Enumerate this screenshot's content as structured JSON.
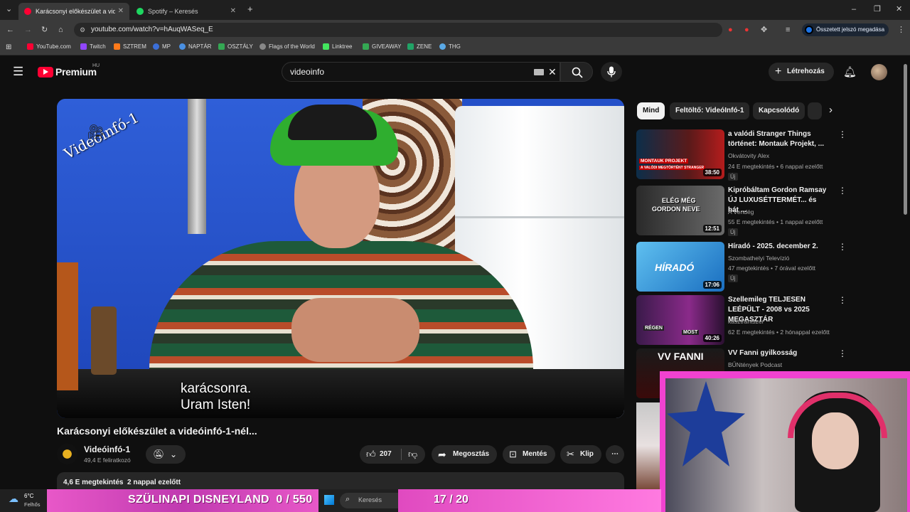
{
  "browser": {
    "tabs": [
      {
        "title": "Karácsonyi előkészület a videói...",
        "active": true,
        "favicon_color": "#ff0033"
      },
      {
        "title": "Spotify – Keresés",
        "active": false,
        "favicon_color": "#1ed760"
      }
    ],
    "new_tab": "+",
    "url": "youtube.com/watch?v=hAuqWASeq_E",
    "password_chip": "Összetett jelszó megadása",
    "bookmarks": [
      {
        "label": "YouTube.com",
        "color": "#ff0033"
      },
      {
        "label": "Twitch",
        "color": "#9146ff"
      },
      {
        "label": "SZTREM",
        "color": "#ff7a1a"
      },
      {
        "label": "MP",
        "color": "#3b6fd8"
      },
      {
        "label": "NAPTÁR",
        "color": "#4a90e2"
      },
      {
        "label": "OSZTÁLY",
        "color": "#34a853"
      },
      {
        "label": "Flags of the World",
        "color": "#888888"
      },
      {
        "label": "Linktree",
        "color": "#43e55e"
      },
      {
        "label": "GIVEAWAY",
        "color": "#34a853"
      },
      {
        "label": "ZENE",
        "color": "#21a366"
      },
      {
        "label": "THG",
        "color": "#5aa9e6"
      }
    ]
  },
  "yt": {
    "logo": "Premium",
    "region": "HU",
    "search_value": "videoinfo",
    "create_label": "Létrehozás"
  },
  "video": {
    "watermark": "Videóinfó-1",
    "caption_line1": "karácsonra.",
    "caption_line2": "Uram Isten!",
    "title": "Karácsonyi előkészület a videóinfó-1-nél...",
    "channel": "Videóinfó-1",
    "subscribers": "49,4 E feliratkozó",
    "likes": "207",
    "share": "Megosztás",
    "save": "Mentés",
    "clip": "Klip",
    "views_line": "4,6 E megtekintés  2 nappal ezelőtt"
  },
  "filters": [
    {
      "label": "Mind",
      "selected": true
    },
    {
      "label": "Feltöltő: VideóInfó-1",
      "selected": false
    },
    {
      "label": "Kapcsolódó",
      "selected": false
    }
  ],
  "recommendations": [
    {
      "title": "a valódi Stranger Things történet: Montauk Projekt, ...",
      "channel": "Okvátovity Alex",
      "meta": "24 E megtekintés • 6 nappal ezelőtt",
      "badge": "Új",
      "duration": "38:50"
    },
    {
      "title": "Kipróbáltam Gordon Ramsay ÚJ LUXUSÉTTERMÉT... és hát ...",
      "channel": "A Vendég",
      "meta": "55 E megtekintés • 1 nappal ezelőtt",
      "badge": "Új",
      "duration": "12:51"
    },
    {
      "title": "Híradó - 2025. december 2.",
      "channel": "Szombathelyi Televízió",
      "meta": "47 megtekintés • 7 órával ezelőtt",
      "badge": "Új",
      "duration": "17:06"
    },
    {
      "title": "Szellemileg TELJESEN LEÉPÜLT - 2008 vs 2025 MEGASZTÁR",
      "channel": "kasztrantszer",
      "meta": "62 E megtekintés • 2 hónappal ezelőtt",
      "badge": "",
      "duration": "40:26"
    },
    {
      "title": "VV Fanni gyilkosság",
      "channel": "BŰNtények Podcast",
      "meta": "",
      "badge": "",
      "duration": ""
    }
  ],
  "thumb_text": {
    "r0a": "MONTAUK PROJEKT",
    "r0b": "A VALÓDI MEGTÖRTÉNT STRANGER",
    "r1a": "ELÉG MÉG",
    "r1b": "GORDON NEVE",
    "r2": "HÍRADÓ",
    "r3a": "RÉGEN",
    "r3b": "MOST",
    "r4": "VV FANNI"
  },
  "stream": {
    "donation_label": "SZÜLINAPI DISNEYLAND",
    "donation_current": "0",
    "donation_goal": "550",
    "sub_current": "17",
    "sub_goal": "20"
  },
  "taskbar": {
    "temp": "6°C",
    "weather": "Felhős",
    "search_placeholder": "Keresés"
  }
}
